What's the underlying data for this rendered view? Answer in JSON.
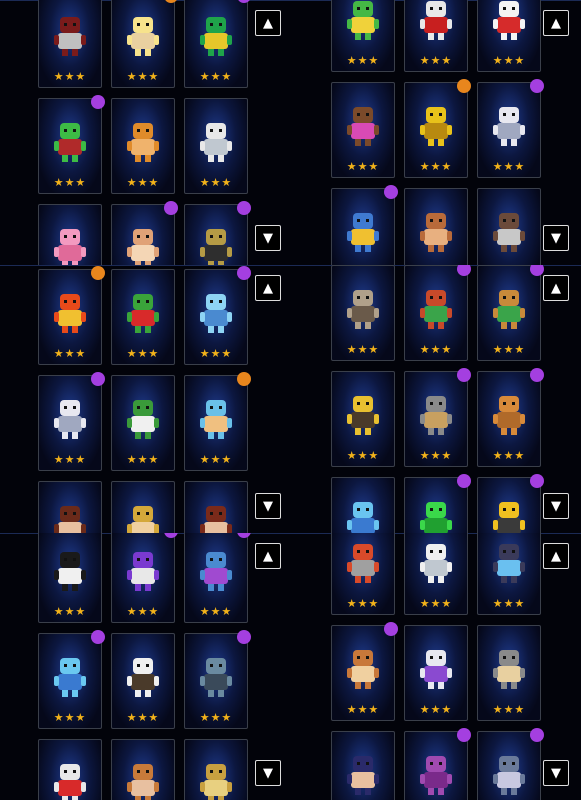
{
  "scroll": {
    "up_label": "▲",
    "down_label": "▼"
  },
  "colors": {
    "star": "#f2b21a",
    "purple_badge": "#a43fe0",
    "orange_badge": "#e8861d"
  },
  "panels": [
    {
      "cards": [
        {
          "stars": "★★★",
          "badge": "none",
          "char": "drummer",
          "c1": "#7a1b1b",
          "c2": "#c0c0c0"
        },
        {
          "stars": "★★★",
          "badge": "orange",
          "char": "golden-deity",
          "c1": "#f7e38c",
          "c2": "#e9d0a0"
        },
        {
          "stars": "★★★",
          "badge": "purple",
          "char": "pipe-creature",
          "c1": "#1fa44a",
          "c2": "#e6c72a"
        },
        {
          "stars": "★★★",
          "badge": "purple",
          "char": "music-frog",
          "c1": "#3dbb45",
          "c2": "#b02a2a"
        },
        {
          "stars": "★★★",
          "badge": "none",
          "char": "orange-fox",
          "c1": "#e08b2a",
          "c2": "#f0b36c"
        },
        {
          "stars": "★★★",
          "badge": "none",
          "char": "white-fox",
          "c1": "#e8e8e8",
          "c2": "#c0c8d0"
        },
        {
          "stars": "★★★",
          "badge": "none",
          "char": "pink-flower",
          "c1": "#f39ac0",
          "c2": "#e06a99"
        },
        {
          "stars": "★★★",
          "badge": "purple",
          "char": "hamster",
          "c1": "#e0a277",
          "c2": "#f4d6b5"
        },
        {
          "stars": "★★★",
          "badge": "purple",
          "char": "golden-mech",
          "c1": "#b59b45",
          "c2": "#2e2e2e"
        }
      ]
    },
    {
      "cards": [
        {
          "stars": "★★★",
          "badge": "none",
          "char": "green-frog",
          "c1": "#45b845",
          "c2": "#f0d23a"
        },
        {
          "stars": "★★★",
          "badge": "none",
          "char": "red-cap-kid",
          "c1": "#e8e8e8",
          "c2": "#c81f1f"
        },
        {
          "stars": "★★★",
          "badge": "none",
          "char": "white-cat",
          "c1": "#f4f4f4",
          "c2": "#d62b2b"
        },
        {
          "stars": "★★★",
          "badge": "none",
          "char": "nerd",
          "c1": "#7b4a2a",
          "c2": "#d84ab5"
        },
        {
          "stars": "★★★",
          "badge": "orange",
          "char": "golden-poop",
          "c1": "#e8c21a",
          "c2": "#b88a10"
        },
        {
          "stars": "★★★",
          "badge": "purple",
          "char": "ghost-cat",
          "c1": "#e8e8f0",
          "c2": "#a0a8c0"
        },
        {
          "stars": "★★★",
          "badge": "purple",
          "char": "blue-robot",
          "c1": "#3f7ad0",
          "c2": "#f0c030"
        },
        {
          "stars": "★★★",
          "badge": "none",
          "char": "mammoth",
          "c1": "#b86a3a",
          "c2": "#e8b080"
        },
        {
          "stars": "★★★",
          "badge": "none",
          "char": "zombie",
          "c1": "#6b4a3a",
          "c2": "#c8c8c8"
        }
      ]
    },
    {
      "cards": [
        {
          "stars": "★★★",
          "badge": "orange",
          "char": "fire-demon",
          "c1": "#e84a1a",
          "c2": "#f0c030"
        },
        {
          "stars": "★★★",
          "badge": "none",
          "char": "cactus",
          "c1": "#3aa43a",
          "c2": "#d82a2a"
        },
        {
          "stars": "★★★",
          "badge": "purple",
          "char": "blue-spirit",
          "c1": "#8ed4f4",
          "c2": "#4a8ad0"
        },
        {
          "stars": "★★★",
          "badge": "purple",
          "char": "squid",
          "c1": "#e8e8f0",
          "c2": "#a0a8c0"
        },
        {
          "stars": "★★★",
          "badge": "none",
          "char": "crocodile",
          "c1": "#3a9a3a",
          "c2": "#f0f0f0"
        },
        {
          "stars": "★★★",
          "badge": "orange",
          "char": "water-god",
          "c1": "#6ac0e8",
          "c2": "#f0c080"
        },
        {
          "stars": "★★★",
          "badge": "none",
          "char": "brown-hair-girl",
          "c1": "#6a2a1a",
          "c2": "#e8c0a0"
        },
        {
          "stars": "★★★",
          "badge": "none",
          "char": "blonde-girl",
          "c1": "#d4a83a",
          "c2": "#f0d0a0"
        },
        {
          "stars": "★★★",
          "badge": "none",
          "char": "red-hair-girl",
          "c1": "#7a2a1a",
          "c2": "#e8c0a0"
        }
      ]
    },
    {
      "cards": [
        {
          "stars": "★★★",
          "badge": "none",
          "char": "phone-booth",
          "c1": "#b0a08a",
          "c2": "#6a5a4a"
        },
        {
          "stars": "★★★",
          "badge": "purple",
          "char": "guardian",
          "c1": "#c84a2a",
          "c2": "#3aa44a"
        },
        {
          "stars": "★★★",
          "badge": "purple",
          "char": "mandrake",
          "c1": "#c88a3a",
          "c2": "#3aa44a"
        },
        {
          "stars": "★★★",
          "badge": "none",
          "char": "werewolf",
          "c1": "#e8c030",
          "c2": "#4a3a2a"
        },
        {
          "stars": "★★★",
          "badge": "purple",
          "char": "gravestone",
          "c1": "#8a8a8a",
          "c2": "#c8a060"
        },
        {
          "stars": "★★★",
          "badge": "purple",
          "char": "haniwa",
          "c1": "#d88a3a",
          "c2": "#b06a2a"
        },
        {
          "stars": "★★★",
          "badge": "none",
          "char": "blue-gem",
          "c1": "#6ac4f0",
          "c2": "#3a7ad0"
        },
        {
          "stars": "★★★",
          "badge": "purple",
          "char": "green-slime",
          "c1": "#3ad84a",
          "c2": "#20a030"
        },
        {
          "stars": "★★★",
          "badge": "purple",
          "char": "excavator",
          "c1": "#f0c020",
          "c2": "#3a3a3a"
        }
      ]
    },
    {
      "cards": [
        {
          "stars": "★★★",
          "badge": "none",
          "char": "black-hair-girl",
          "c1": "#1a1a1a",
          "c2": "#f0f0f0"
        },
        {
          "stars": "★★★",
          "badge": "purple",
          "char": "ghost-woman",
          "c1": "#7a3ad0",
          "c2": "#e8e8e8"
        },
        {
          "stars": "★★★",
          "badge": "purple",
          "char": "blue-dragon",
          "c1": "#4a8ad0",
          "c2": "#a04ad0"
        },
        {
          "stars": "★★★",
          "badge": "purple",
          "char": "blue-maiden",
          "c1": "#6ac8f0",
          "c2": "#3a7ad0"
        },
        {
          "stars": "★★★",
          "badge": "none",
          "char": "white-robe-girl",
          "c1": "#f0f0f0",
          "c2": "#4a3a2a"
        },
        {
          "stars": "★★★",
          "badge": "purple",
          "char": "android",
          "c1": "#6a8aa0",
          "c2": "#3a4a5a"
        },
        {
          "stars": "★★★",
          "badge": "none",
          "char": "cap-boy",
          "c1": "#e8e8e8",
          "c2": "#d82a2a"
        },
        {
          "stars": "★★★",
          "badge": "none",
          "char": "chest-man",
          "c1": "#c87a3a",
          "c2": "#e8c0a0"
        },
        {
          "stars": "★★★",
          "badge": "none",
          "char": "golden-bird",
          "c1": "#c8a040",
          "c2": "#e8d080"
        }
      ]
    },
    {
      "cards": [
        {
          "stars": "★★★",
          "badge": "none",
          "char": "red-box",
          "c1": "#d84a2a",
          "c2": "#a0a0a0"
        },
        {
          "stars": "★★★",
          "badge": "none",
          "char": "seal",
          "c1": "#f0f0f0",
          "c2": "#c0c8d0"
        },
        {
          "stars": "★★★",
          "badge": "none",
          "char": "dark-blob",
          "c1": "#3a3a5a",
          "c2": "#6ac0f0"
        },
        {
          "stars": "★★★",
          "badge": "purple",
          "char": "tanuki",
          "c1": "#c8783a",
          "c2": "#f0d0a0"
        },
        {
          "stars": "★★★",
          "badge": "none",
          "char": "armored-cat",
          "c1": "#e8e8f0",
          "c2": "#8a4ad0"
        },
        {
          "stars": "★★★",
          "badge": "none",
          "char": "small-knight",
          "c1": "#8a8a8a",
          "c2": "#e8d0a0"
        },
        {
          "stars": "★★★",
          "badge": "none",
          "char": "blue-hair-boy",
          "c1": "#2a2a6a",
          "c2": "#e8c0a0"
        },
        {
          "stars": "★★★",
          "badge": "purple",
          "char": "purple-golem",
          "c1": "#a04ab0",
          "c2": "#7a2a8a"
        },
        {
          "stars": "★★★",
          "badge": "purple",
          "char": "reaper",
          "c1": "#6a7a9a",
          "c2": "#c8c8e0"
        }
      ]
    }
  ]
}
